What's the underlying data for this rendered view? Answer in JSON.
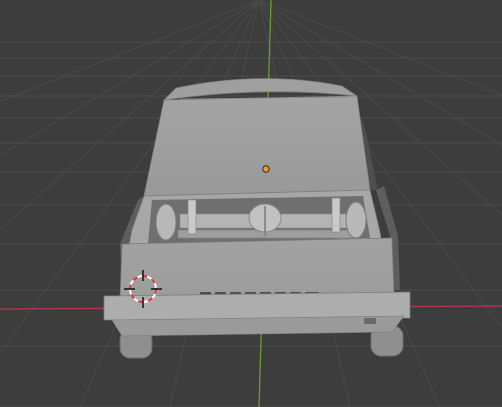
{
  "viewport": {
    "background": "#3d3d3d",
    "grid_color": "#4a4a4a",
    "x_axis_color": "#b53a4c",
    "y_axis_color": "#6e9a32",
    "model_color": "#a9a9a9",
    "origin_color": "#f0a020"
  },
  "icons": {
    "cursor": "3d-cursor-icon",
    "origin": "object-origin-icon"
  }
}
